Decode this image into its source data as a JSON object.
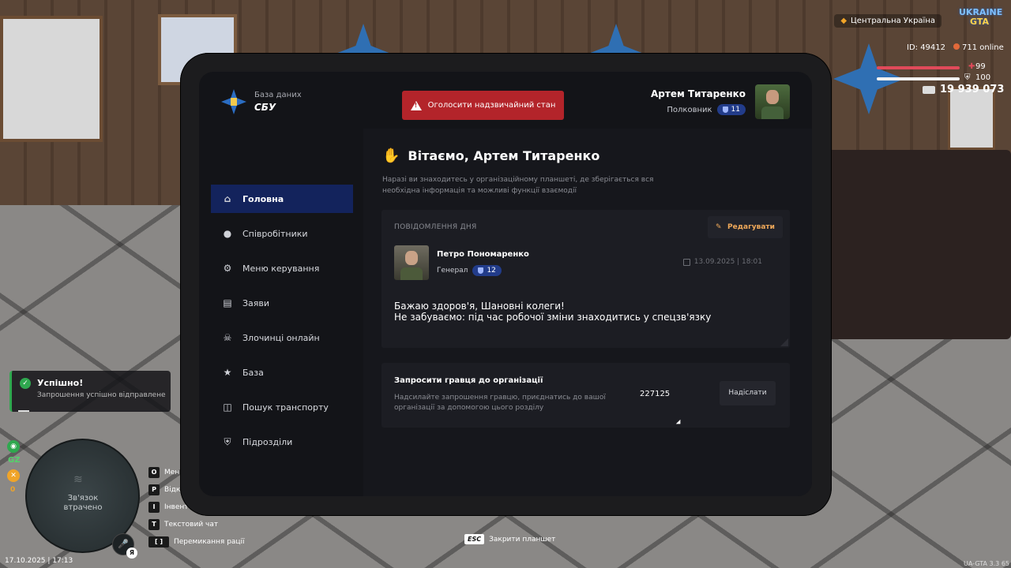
{
  "hud": {
    "region": "Центральна Україна",
    "logo_top": "UKRAINE",
    "logo_bottom": "GTA",
    "id": "ID: 49412",
    "online": "711 online",
    "health": "99",
    "armor": "100",
    "money": "19 939 073",
    "datetime": "17.10.2025 | 17:13",
    "version": "UA-GTA 3.3",
    "fps": "65",
    "minimap_text": "Зв'язок\nвтрачено",
    "gz_label": "GZ",
    "zero_label": "0",
    "mic_badge": "Я"
  },
  "notification": {
    "title": "Успішно!",
    "text": "Запрошення успішно відправлене"
  },
  "keybinds": [
    {
      "key": "O",
      "label": "Мені"
    },
    {
      "key": "P",
      "label": "Відк"
    },
    {
      "key": "I",
      "label": "Інвент"
    },
    {
      "key": "T",
      "label": "Текстовий чат"
    },
    {
      "key": "[ ]",
      "label": "Перемикання рації"
    }
  ],
  "esc_hint": {
    "key": "ESC",
    "label": "Закрити планшет"
  },
  "tablet": {
    "brand_small": "База даних",
    "brand_big": "СБУ",
    "alarm_label": "Оголосити надзвичайний стан",
    "user_name": "Артем Титаренко",
    "user_rank": "Полковник",
    "user_level": "11",
    "nav": [
      {
        "label": "Головна",
        "icon": "home-icon"
      },
      {
        "label": "Співробітники",
        "icon": "users-icon"
      },
      {
        "label": "Меню керування",
        "icon": "gear-icon"
      },
      {
        "label": "Заяви",
        "icon": "folder-icon"
      },
      {
        "label": "Злочинці онлайн",
        "icon": "skull-icon"
      },
      {
        "label": "База",
        "icon": "star-icon"
      },
      {
        "label": "Пошук транспорту",
        "icon": "car-icon"
      },
      {
        "label": "Підрозділи",
        "icon": "shield-icon"
      }
    ],
    "welcome_title": "Вітаємо, Артем Титаренко",
    "welcome_sub": "Наразі ви знаходитесь у організаційному планшеті, де зберігається вся необхідна інформація та можливі функції взаємодії",
    "message": {
      "label": "ПОВІДОМЛЕННЯ ДНЯ",
      "edit_label": "Редагувати",
      "author": "Петро Пономаренко",
      "author_rank": "Генерал",
      "author_level": "12",
      "date": "13.09.2025 | 18:01",
      "body_line1": "Бажаю здоров'я, Шановні колеги!",
      "body_line2": "Не забуваємо: під час робочої зміни знаходитись у спецзв'язку"
    },
    "invite": {
      "title": "Запросити гравця до організації",
      "text": "Надсилайте запрошення гравцю, приєднатись до вашої організації за допомогою цього розділу",
      "input_value": "227125",
      "button_label": "Надіслати"
    }
  },
  "colors": {
    "accent_nav": "#13235c",
    "alarm": "#b3242a",
    "edit": "#f0a95a",
    "success": "#2fa84f"
  }
}
